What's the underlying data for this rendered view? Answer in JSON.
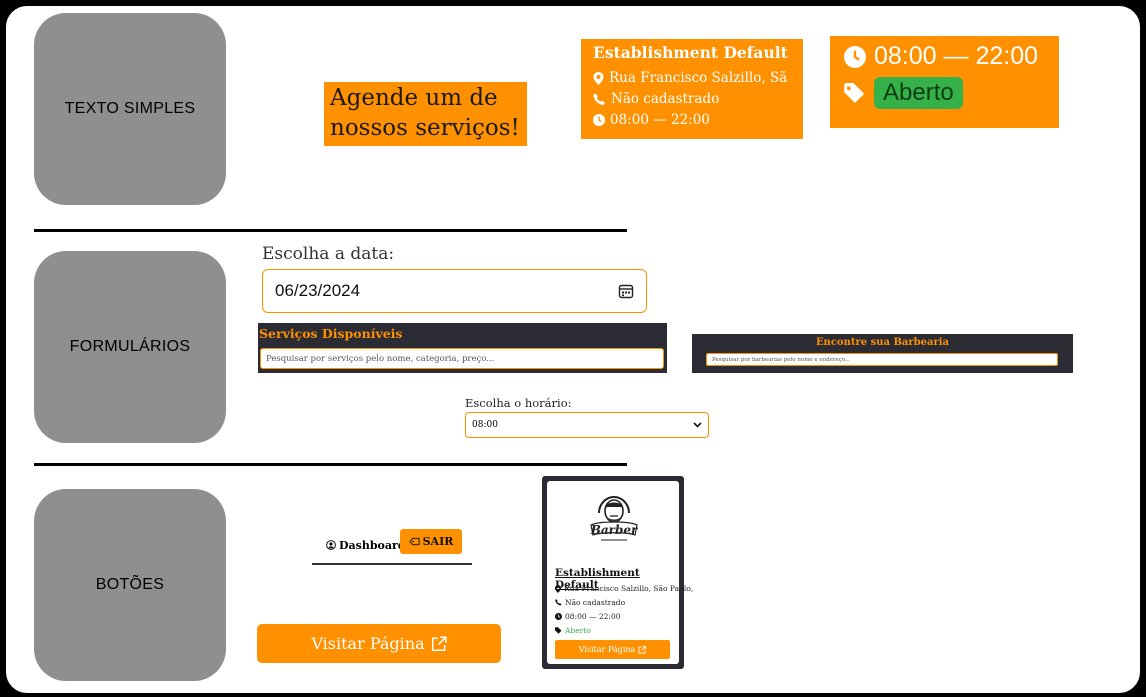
{
  "sections": {
    "text": "TEXTO SIMPLES",
    "forms": "FORMULÁRIOS",
    "buttons": "BOTÕES"
  },
  "hero": {
    "line1": "Agende um de",
    "line2": "nossos serviços!"
  },
  "establishment": {
    "name": "Establishment Default",
    "address": "Rua Francisco Salzillo, Sã",
    "phone": "Não cadastrado",
    "hours": "08:00 — 22:00"
  },
  "hours_card": {
    "hours": "08:00 — 22:00",
    "status": "Aberto"
  },
  "date_field": {
    "label": "Escolha a data:",
    "value": "06/23/2024"
  },
  "services_panel": {
    "title": "Serviços Disponíveis",
    "placeholder": "Pesquisar por serviços pelo nome, categoria, preço..."
  },
  "barbershop_panel": {
    "title": "Encontre sua Barbearia",
    "placeholder": "Pesquisar por barbearias pelo nome e endereço..."
  },
  "time_field": {
    "label": "Escolha o horário:",
    "value": "08:00"
  },
  "nav": {
    "dashboard": "Dashboard",
    "logout": "SAIR"
  },
  "visit_button": {
    "label": "Visitar Página"
  },
  "mini_card": {
    "logo_text": "Barber",
    "name": "Establishment Default",
    "address": "Rua Francisco Salzillo, São Paulo,",
    "phone": "Não cadastrado",
    "hours": "08:00 — 22:00",
    "status": "Aberto",
    "button": "Visitar Página"
  },
  "colors": {
    "accent": "#ff9100",
    "dark": "#2b2b33",
    "open": "#36b14a",
    "label_box": "#8f8f8f"
  }
}
